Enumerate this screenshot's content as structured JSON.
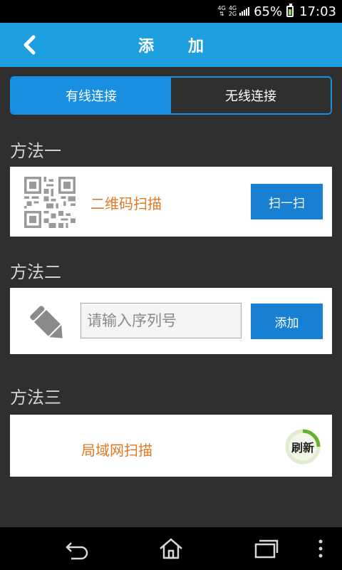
{
  "status_bar": {
    "network_top": "4G",
    "network_bottom_a": "4G",
    "network_bottom_b": "2G",
    "battery_percent": "65%",
    "battery_level": 0.65,
    "time": "17:03"
  },
  "header": {
    "title": "添加",
    "back_icon": "chevron-left-icon"
  },
  "tabs": [
    {
      "label": "有线连接",
      "active": true
    },
    {
      "label": "无线连接",
      "active": false
    }
  ],
  "method1": {
    "label": "方法一",
    "icon": "qr-code-icon",
    "text": "二维码扫描",
    "button_label": "扫一扫"
  },
  "method2": {
    "label": "方法二",
    "icon": "pencil-icon",
    "input_value": "",
    "input_placeholder": "请输入序列号",
    "button_label": "添加"
  },
  "method3": {
    "label": "方法三",
    "text": "局域网扫描",
    "refresh_label": "刷新"
  },
  "nav_bar": {
    "back_icon": "back-arrow-icon",
    "home_icon": "home-icon",
    "recents_icon": "recent-apps-icon",
    "menu_icon": "overflow-menu-icon"
  },
  "colors": {
    "accent": "#1ea0e0",
    "tab_active": "#1a8ee0",
    "button": "#1880d2",
    "orange_text": "#e07a22",
    "background": "#2f2f2f"
  }
}
